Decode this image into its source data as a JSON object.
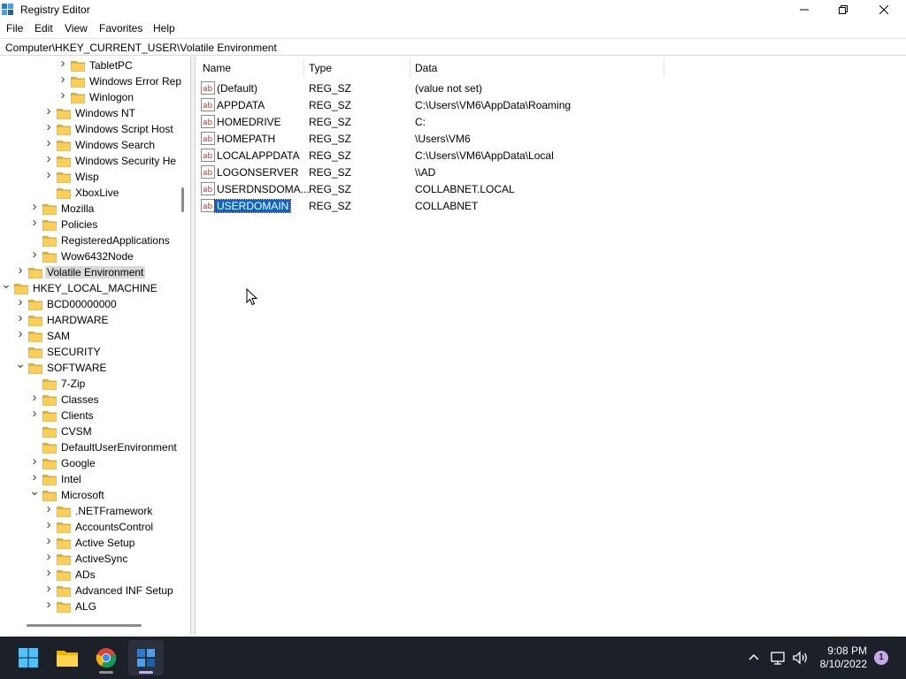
{
  "window": {
    "title": "Registry Editor",
    "icon": "regedit-icon",
    "controls": {
      "minimize": "minimize-icon",
      "maximize": "restore-icon",
      "close": "close-icon"
    }
  },
  "menu": [
    "File",
    "Edit",
    "View",
    "Favorites",
    "Help"
  ],
  "address": "Computer\\HKEY_CURRENT_USER\\Volatile Environment",
  "tree": [
    {
      "label": "TabletPC",
      "level": 4,
      "chevron": "collapsed"
    },
    {
      "label": "Windows Error Rep",
      "level": 4,
      "chevron": "collapsed"
    },
    {
      "label": "Winlogon",
      "level": 4,
      "chevron": "collapsed"
    },
    {
      "label": "Windows NT",
      "level": 3,
      "chevron": "collapsed"
    },
    {
      "label": "Windows Script Host",
      "level": 3,
      "chevron": "collapsed"
    },
    {
      "label": "Windows Search",
      "level": 3,
      "chevron": "collapsed"
    },
    {
      "label": "Windows Security He",
      "level": 3,
      "chevron": "collapsed"
    },
    {
      "label": "Wisp",
      "level": 3,
      "chevron": "collapsed"
    },
    {
      "label": "XboxLive",
      "level": 3,
      "chevron": "none"
    },
    {
      "label": "Mozilla",
      "level": 2,
      "chevron": "collapsed"
    },
    {
      "label": "Policies",
      "level": 2,
      "chevron": "collapsed"
    },
    {
      "label": "RegisteredApplications",
      "level": 2,
      "chevron": "none"
    },
    {
      "label": "Wow6432Node",
      "level": 2,
      "chevron": "collapsed"
    },
    {
      "label": "Volatile Environment",
      "level": 1,
      "chevron": "collapsed",
      "selected": true
    },
    {
      "label": "HKEY_LOCAL_MACHINE",
      "level": 0,
      "chevron": "expanded"
    },
    {
      "label": "BCD00000000",
      "level": 1,
      "chevron": "collapsed"
    },
    {
      "label": "HARDWARE",
      "level": 1,
      "chevron": "collapsed"
    },
    {
      "label": "SAM",
      "level": 1,
      "chevron": "collapsed"
    },
    {
      "label": "SECURITY",
      "level": 1,
      "chevron": "none"
    },
    {
      "label": "SOFTWARE",
      "level": 1,
      "chevron": "expanded"
    },
    {
      "label": "7-Zip",
      "level": 2,
      "chevron": "none"
    },
    {
      "label": "Classes",
      "level": 2,
      "chevron": "collapsed"
    },
    {
      "label": "Clients",
      "level": 2,
      "chevron": "collapsed"
    },
    {
      "label": "CVSM",
      "level": 2,
      "chevron": "none"
    },
    {
      "label": "DefaultUserEnvironment",
      "level": 2,
      "chevron": "none"
    },
    {
      "label": "Google",
      "level": 2,
      "chevron": "collapsed"
    },
    {
      "label": "Intel",
      "level": 2,
      "chevron": "collapsed"
    },
    {
      "label": "Microsoft",
      "level": 2,
      "chevron": "expanded"
    },
    {
      "label": ".NETFramework",
      "level": 3,
      "chevron": "collapsed"
    },
    {
      "label": "AccountsControl",
      "level": 3,
      "chevron": "collapsed"
    },
    {
      "label": "Active Setup",
      "level": 3,
      "chevron": "collapsed"
    },
    {
      "label": "ActiveSync",
      "level": 3,
      "chevron": "collapsed"
    },
    {
      "label": "ADs",
      "level": 3,
      "chevron": "collapsed"
    },
    {
      "label": "Advanced INF Setup",
      "level": 3,
      "chevron": "collapsed"
    },
    {
      "label": "ALG",
      "level": 3,
      "chevron": "collapsed"
    }
  ],
  "columns": {
    "name": "Name",
    "type": "Type",
    "data": "Data"
  },
  "values": [
    {
      "name": "(Default)",
      "type": "REG_SZ",
      "data": "(value not set)"
    },
    {
      "name": "APPDATA",
      "type": "REG_SZ",
      "data": "C:\\Users\\VM6\\AppData\\Roaming"
    },
    {
      "name": "HOMEDRIVE",
      "type": "REG_SZ",
      "data": "C:"
    },
    {
      "name": "HOMEPATH",
      "type": "REG_SZ",
      "data": "\\Users\\VM6"
    },
    {
      "name": "LOCALAPPDATA",
      "type": "REG_SZ",
      "data": "C:\\Users\\VM6\\AppData\\Local"
    },
    {
      "name": "LOGONSERVER",
      "type": "REG_SZ",
      "data": "\\\\AD"
    },
    {
      "name": "USERDNSDOMA...",
      "type": "REG_SZ",
      "data": "COLLABNET.LOCAL"
    },
    {
      "name": "USERDOMAIN",
      "type": "REG_SZ",
      "data": "COLLABNET",
      "selected": true
    }
  ],
  "taskbar": {
    "apps": [
      "windows-start-icon",
      "file-explorer-icon",
      "chrome-icon",
      "regedit-icon"
    ],
    "active_app": "regedit-icon",
    "tray": [
      "chevron-up-icon",
      "network-icon",
      "volume-icon"
    ],
    "time": "9:08 PM",
    "date": "8/10/2022",
    "notification_count": "1"
  },
  "colors": {
    "selection": "#0a64c8",
    "tree_selection": "#d9d9d9",
    "taskbar": "#1c2028",
    "folder": "#f5c542"
  }
}
